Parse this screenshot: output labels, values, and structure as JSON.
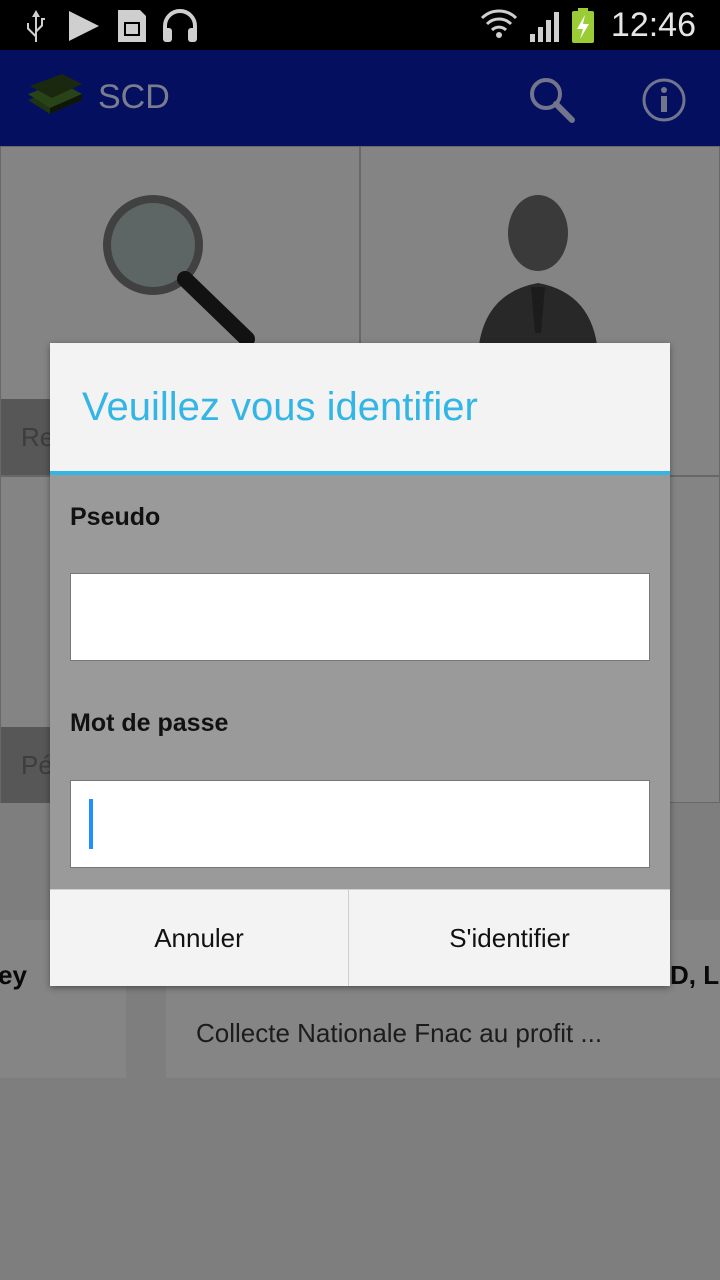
{
  "status_bar": {
    "time": "12:46",
    "icons": [
      "usb-icon",
      "play-icon",
      "sd-card-icon",
      "headset-icon",
      "wifi-icon",
      "signal-icon",
      "battery-charging-icon"
    ]
  },
  "action_bar": {
    "title": "SCD",
    "icons": [
      "app-logo-icon",
      "search-icon",
      "info-icon"
    ]
  },
  "background": {
    "tile_labels": [
      "Re",
      "Pé"
    ],
    "news_items": [
      {
        "title_fragment": "ey"
      },
      {
        "title_fragment": "D, L",
        "snippet": "Collecte Nationale Fnac au profit ..."
      }
    ]
  },
  "dialog": {
    "title": "Veuillez vous identifier",
    "pseudo_label": "Pseudo",
    "pseudo_value": "",
    "password_label": "Mot de passe",
    "password_value": "",
    "cancel_label": "Annuler",
    "login_label": "S'identifier"
  },
  "colors": {
    "action_bar": "#0a1db0",
    "dialog_accent": "#33b5e5",
    "cursor": "#1e90ff"
  }
}
